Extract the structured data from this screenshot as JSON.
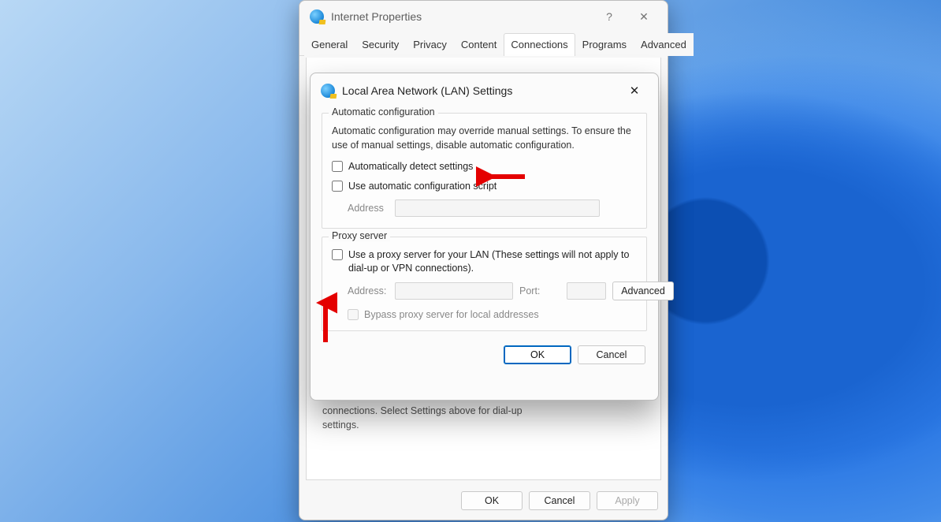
{
  "internet_properties": {
    "title": "Internet Properties",
    "help_symbol": "?",
    "close_symbol": "✕",
    "tabs": [
      "General",
      "Security",
      "Privacy",
      "Content",
      "Connections",
      "Programs",
      "Advanced"
    ],
    "active_tab_index": 4,
    "partial_text": "connections. Select Settings above for dial-up settings.",
    "buttons": {
      "ok": "OK",
      "cancel": "Cancel",
      "apply": "Apply"
    }
  },
  "lan": {
    "title": "Local Area Network (LAN) Settings",
    "close_symbol": "✕",
    "auto": {
      "legend": "Automatic configuration",
      "desc": "Automatic configuration may override manual settings.  To ensure the use of manual settings, disable automatic configuration.",
      "auto_detect_label": "Automatically detect settings",
      "auto_detect_checked": false,
      "use_script_label": "Use automatic configuration script",
      "use_script_checked": false,
      "address_label": "Address",
      "address_value": ""
    },
    "proxy": {
      "legend": "Proxy server",
      "use_proxy_label": "Use a proxy server for your LAN (These settings will not apply to dial-up or VPN connections).",
      "use_proxy_checked": false,
      "address_label": "Address:",
      "address_value": "",
      "port_label": "Port:",
      "port_value": "",
      "advanced_label": "Advanced",
      "bypass_label": "Bypass proxy server for local addresses",
      "bypass_checked": false
    },
    "buttons": {
      "ok": "OK",
      "cancel": "Cancel"
    }
  }
}
